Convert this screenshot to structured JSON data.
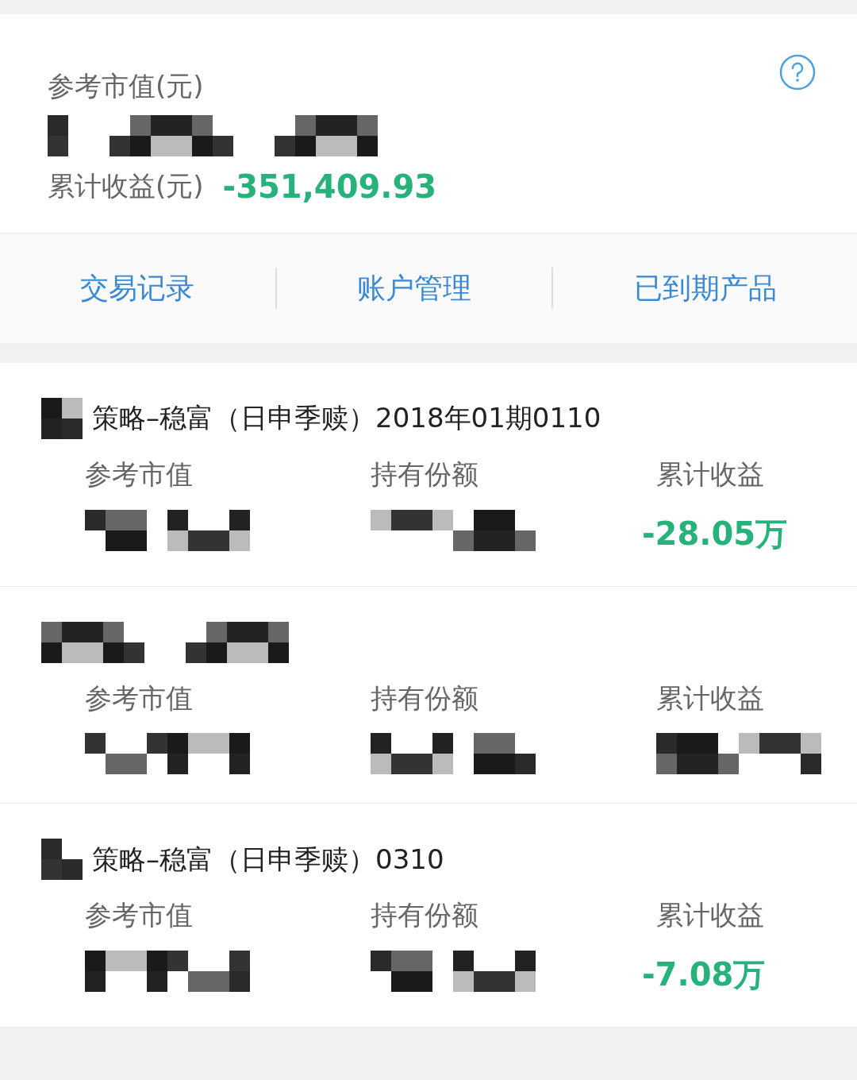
{
  "summary": {
    "market_value": {
      "label": "参考市值(元)",
      "value": {
        "kind": "redacted"
      }
    },
    "total_return": {
      "label": "累计收益(元)",
      "value": {
        "kind": "text",
        "text": "-351,409.93"
      }
    }
  },
  "actions": [
    {
      "label": "交易记录"
    },
    {
      "label": "账户管理"
    },
    {
      "label": "已到期产品"
    }
  ],
  "products": [
    {
      "title": [
        {
          "kind": "redacted"
        },
        {
          "kind": "text",
          "text": "策略–稳富（日申季赎）2018年01期0110"
        }
      ],
      "fields": [
        {
          "label": "参考市值",
          "value": {
            "kind": "redacted"
          }
        },
        {
          "label": "持有份额",
          "value": {
            "kind": "redacted"
          }
        },
        {
          "label": "累计收益",
          "value": {
            "kind": "text",
            "text": "-28.05万"
          }
        }
      ]
    },
    {
      "title": [
        {
          "kind": "redacted"
        }
      ],
      "fields": [
        {
          "label": "参考市值",
          "value": {
            "kind": "redacted"
          }
        },
        {
          "label": "持有份额",
          "value": {
            "kind": "redacted"
          }
        },
        {
          "label": "累计收益",
          "value": {
            "kind": "redacted"
          }
        }
      ]
    },
    {
      "title": [
        {
          "kind": "redacted"
        },
        {
          "kind": "text",
          "text": "策略–稳富（日申季赎）0310"
        }
      ],
      "fields": [
        {
          "label": "参考市值",
          "value": {
            "kind": "redacted"
          }
        },
        {
          "label": "持有份额",
          "value": {
            "kind": "redacted"
          }
        },
        {
          "label": "累计收益",
          "value": {
            "kind": "text",
            "text": "-7.08万"
          }
        }
      ]
    }
  ]
}
